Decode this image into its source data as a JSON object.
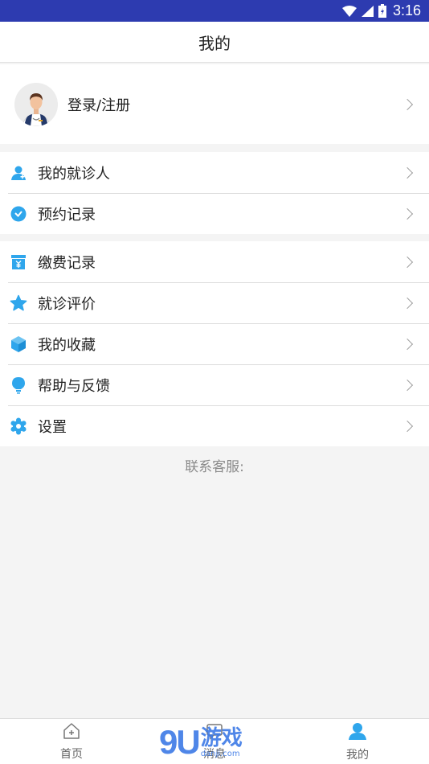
{
  "status_bar": {
    "time": "3:16",
    "icons": [
      "wifi-icon",
      "signal-icon",
      "battery-icon"
    ]
  },
  "header": {
    "title": "我的"
  },
  "profile": {
    "label": "登录/注册"
  },
  "menu_groups": [
    {
      "items": [
        {
          "label": "我的就诊人",
          "icon": "patient-icon"
        },
        {
          "label": "预约记录",
          "icon": "clock-icon"
        }
      ]
    },
    {
      "items": [
        {
          "label": "缴费记录",
          "icon": "payment-icon"
        },
        {
          "label": "就诊评价",
          "icon": "star-icon"
        },
        {
          "label": "我的收藏",
          "icon": "cube-icon"
        },
        {
          "label": "帮助与反馈",
          "icon": "bulb-icon"
        },
        {
          "label": "设置",
          "icon": "gear-icon"
        }
      ]
    }
  ],
  "contact": {
    "label": "联系客服:"
  },
  "tabbar": {
    "tabs": [
      {
        "label": "首页",
        "icon": "home-icon",
        "active": false
      },
      {
        "label": "消息",
        "icon": "message-icon",
        "active": false
      },
      {
        "label": "我的",
        "icon": "user-icon",
        "active": true
      }
    ]
  },
  "watermark": {
    "number": "9U",
    "text": "游戏",
    "url": "danji.com"
  },
  "colors": {
    "accent": "#2fa6ec",
    "status_bar": "#2d3bb0",
    "background": "#f4f4f4"
  }
}
